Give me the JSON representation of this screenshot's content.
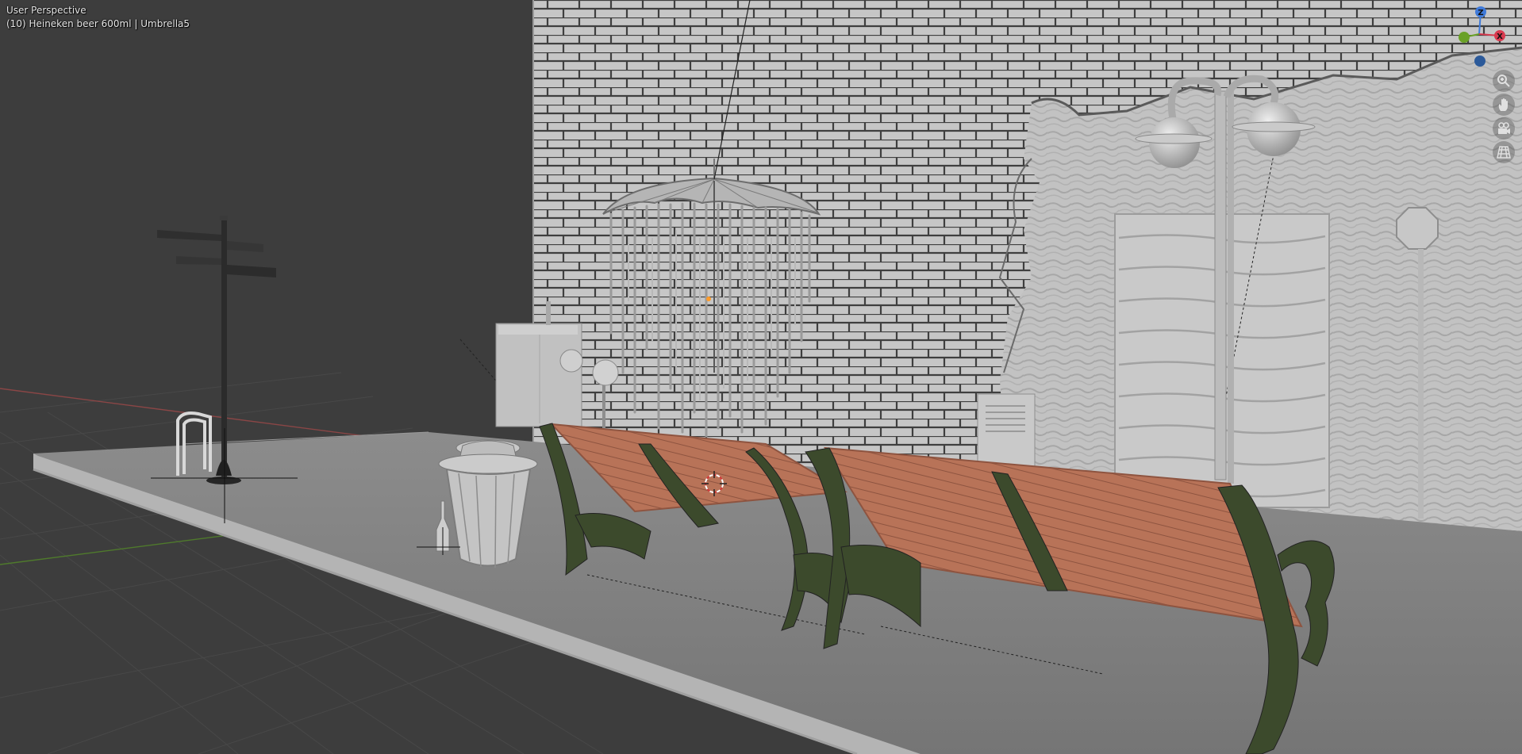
{
  "viewport": {
    "view_name": "User Perspective",
    "object_info": "(10) Heineken beer 600ml | Umbrella5"
  },
  "gizmo": {
    "z_label": "Z",
    "x_label": "X",
    "colors": {
      "x": "#d93a4f",
      "y": "#6aa127",
      "z": "#3f7ad9",
      "neg": "#2c5a9a"
    }
  },
  "nav_buttons": [
    {
      "name": "zoom",
      "icon": "zoom-icon"
    },
    {
      "name": "pan",
      "icon": "hand-icon"
    },
    {
      "name": "camera-view",
      "icon": "camera-icon"
    },
    {
      "name": "perspective-toggle",
      "icon": "grid-icon"
    }
  ],
  "colors": {
    "background": "#3d3d3d",
    "wall": "#bdbdbd",
    "mortar": "#4a4a4a",
    "bench_wood": "#b87358",
    "bench_iron": "#3c4a2c",
    "axis_x": "#8a4646",
    "axis_y": "#4f7a2c"
  }
}
